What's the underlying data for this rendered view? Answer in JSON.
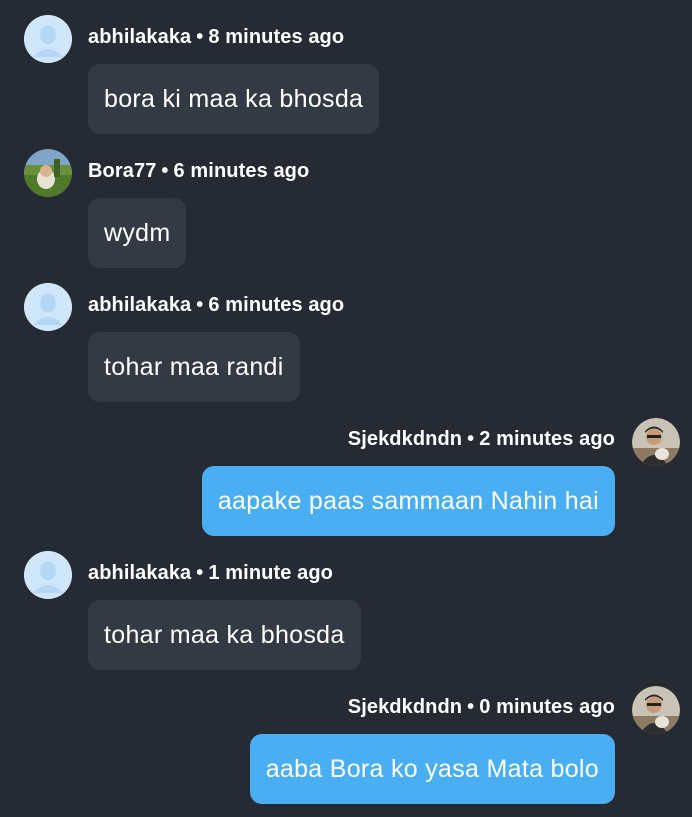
{
  "messages": [
    {
      "side": "left",
      "user": "abhilakaka",
      "separator": "•",
      "time": "8 minutes ago",
      "text": "bora ki maa ka bhosda",
      "avatar": "default-user-avatar"
    },
    {
      "side": "left",
      "user": "Bora77",
      "separator": "•",
      "time": "6 minutes ago",
      "text": "wydm",
      "avatar": "photo-avatar-field"
    },
    {
      "side": "left",
      "user": "abhilakaka",
      "separator": "•",
      "time": "6 minutes ago",
      "text": "tohar maa randi",
      "avatar": "default-user-avatar"
    },
    {
      "side": "right",
      "user": "Sjekdkdndn",
      "separator": "•",
      "time": "2 minutes ago",
      "text": "aapake paas sammaan Nahin hai",
      "avatar": "photo-avatar-person"
    },
    {
      "side": "left",
      "user": "abhilakaka",
      "separator": "•",
      "time": "1 minute ago",
      "text": "tohar maa ka bhosda",
      "avatar": "default-user-avatar"
    },
    {
      "side": "right",
      "user": "Sjekdkdndn",
      "separator": "•",
      "time": "0 minutes ago",
      "text": "aaba Bora ko yasa Mata bolo",
      "avatar": "photo-avatar-person"
    }
  ],
  "colors": {
    "background": "#262a33",
    "incoming_bubble": "#343a43",
    "outgoing_bubble": "#4aaef3",
    "default_avatar": "#cfe6fb"
  }
}
